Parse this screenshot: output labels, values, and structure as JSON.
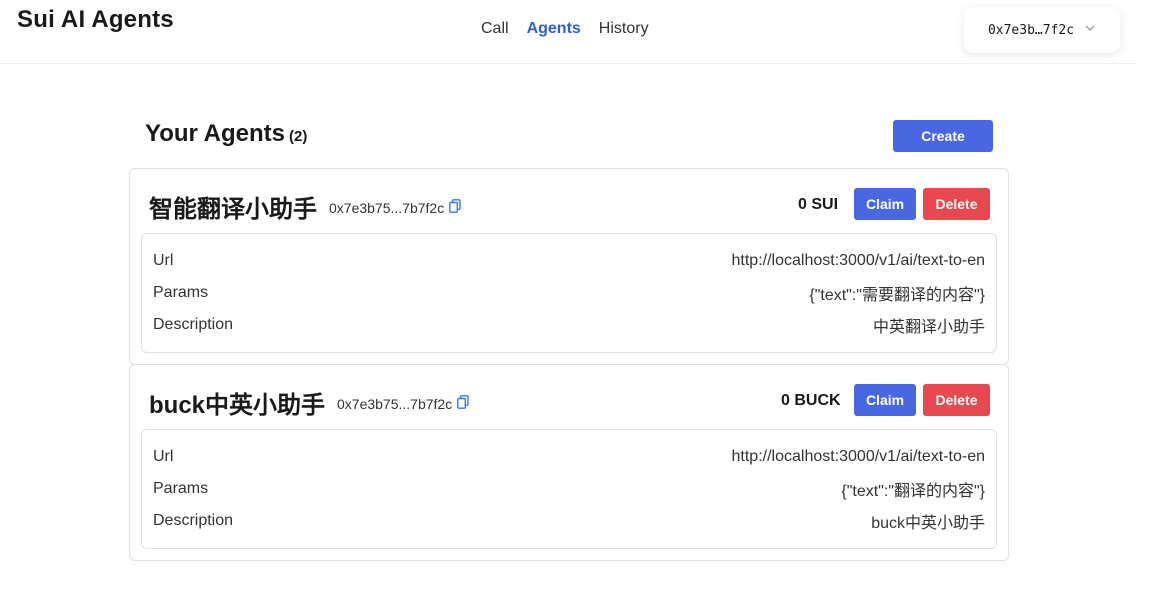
{
  "app": {
    "title": "Sui AI Agents"
  },
  "nav": {
    "tabs": [
      {
        "label": "Call"
      },
      {
        "label": "Agents"
      },
      {
        "label": "History"
      }
    ],
    "active": "Agents"
  },
  "wallet": {
    "address": "0x7e3b…7f2c"
  },
  "section": {
    "title": "Your Agents",
    "count": "(2)",
    "create_label": "Create"
  },
  "labels": {
    "url": "Url",
    "params": "Params",
    "description": "Description",
    "claim": "Claim",
    "delete": "Delete"
  },
  "agents": [
    {
      "name": "智能翻译小助手",
      "address": "0x7e3b75...7b7f2c",
      "balance": "0 SUI",
      "url": "http://localhost:3000/v1/ai/text-to-en",
      "params": "{\"text\":\"需要翻译的内容\"}",
      "description": "中英翻译小助手"
    },
    {
      "name": "buck中英小助手",
      "address": "0x7e3b75...7b7f2c",
      "balance": "0 BUCK",
      "url": "http://localhost:3000/v1/ai/text-to-en",
      "params": "{\"text\":\"翻译的内容\"}",
      "description": "buck中英小助手"
    }
  ],
  "colors": {
    "primary": "#4a67e2",
    "danger": "#e8484f",
    "active_tab": "#2f5fd4",
    "copy_icon": "#2f7bf0"
  }
}
